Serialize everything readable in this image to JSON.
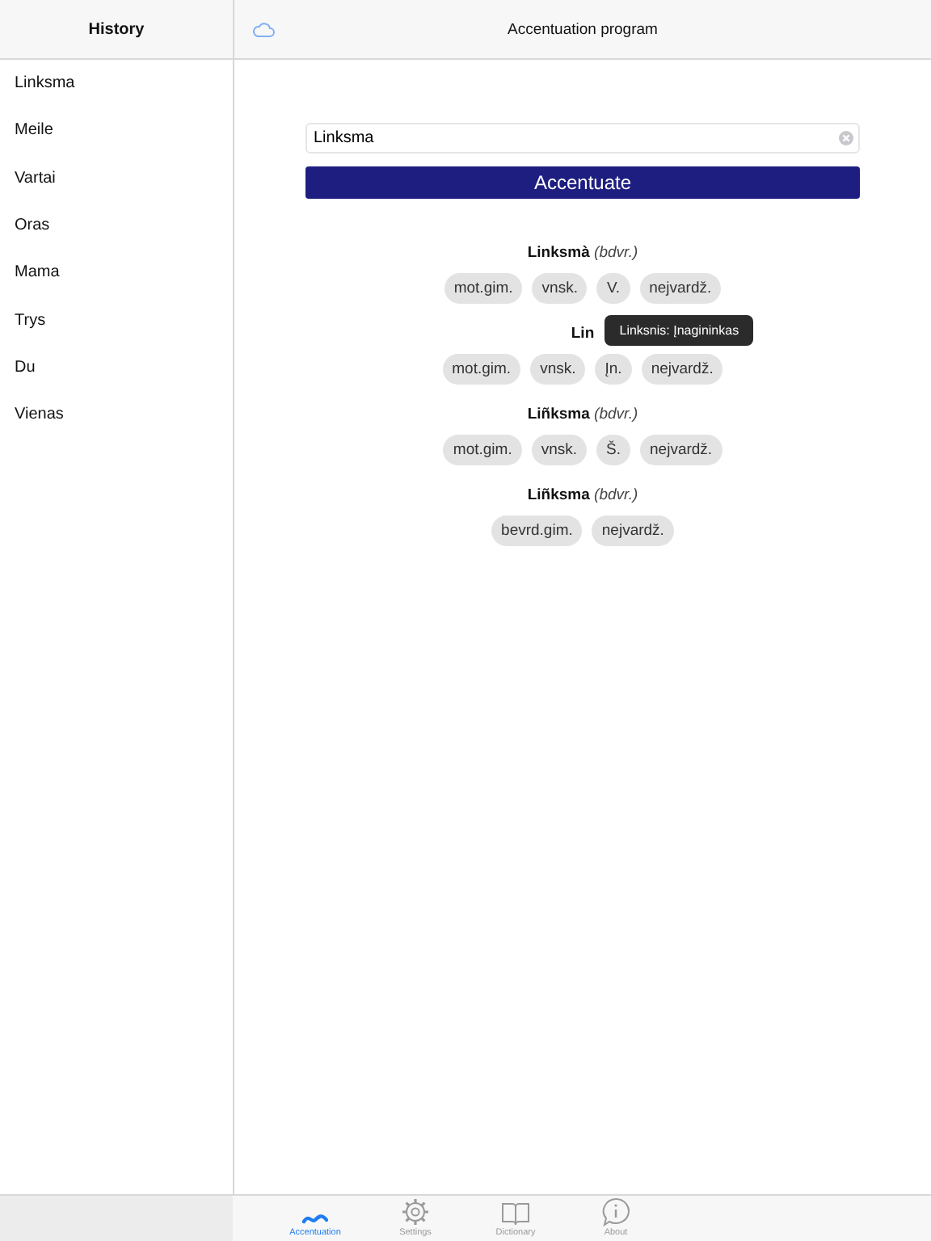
{
  "sidebar": {
    "title": "History",
    "items": [
      {
        "label": "Linksma"
      },
      {
        "label": "Meile"
      },
      {
        "label": "Vartai"
      },
      {
        "label": "Oras"
      },
      {
        "label": "Mama"
      },
      {
        "label": "Trys"
      },
      {
        "label": "Du"
      },
      {
        "label": "Vienas"
      }
    ]
  },
  "header": {
    "title": "Accentuation program"
  },
  "search": {
    "value": "Linksma"
  },
  "button": "Accentuate",
  "results": [
    {
      "word": "Linksmà",
      "pos": "(bdvr.)",
      "tags": [
        {
          "label": "mot.gim."
        },
        {
          "label": "vnsk."
        },
        {
          "label": "V."
        },
        {
          "label": "nejvardž."
        }
      ]
    },
    {
      "word": "Lin",
      "tags": [
        {
          "label": "mot.gim."
        },
        {
          "label": "vnsk."
        },
        {
          "label": "Įn.",
          "tooltip": "Linksnis: Įnagininkas"
        },
        {
          "label": "nejvardž."
        }
      ]
    },
    {
      "word": "Liñksma",
      "pos": "(bdvr.)",
      "tags": [
        {
          "label": "mot.gim."
        },
        {
          "label": "vnsk."
        },
        {
          "label": "Š."
        },
        {
          "label": "nejvardž."
        }
      ]
    },
    {
      "word": "Liñksma",
      "pos": "(bdvr.)",
      "tags": [
        {
          "label": "bevrd.gim."
        },
        {
          "label": "nejvardž."
        }
      ]
    }
  ],
  "tabs": [
    {
      "kind": "wave",
      "label": "Accentuation",
      "selected": true
    },
    {
      "kind": "gear",
      "label": "Settings",
      "selected": false
    },
    {
      "kind": "book",
      "label": "Dictionary",
      "selected": false
    },
    {
      "kind": "info",
      "label": "About",
      "selected": false
    }
  ]
}
